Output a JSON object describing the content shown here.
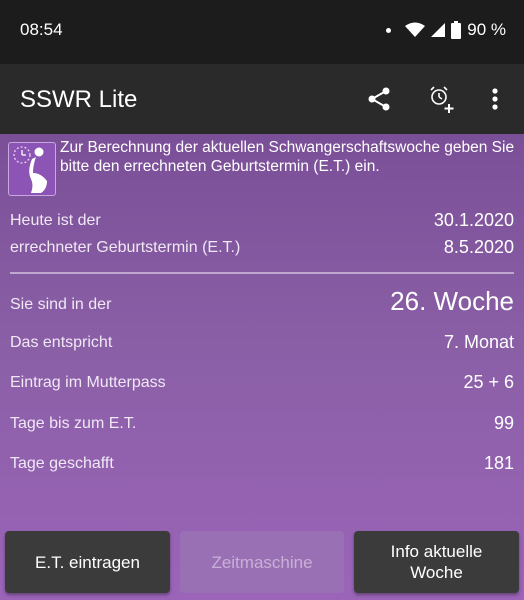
{
  "status": {
    "time": "08:54",
    "battery": "90 %"
  },
  "appbar": {
    "title": "SSWR Lite",
    "icons": [
      "share-icon",
      "alarm-add-icon",
      "more-vert-icon"
    ]
  },
  "intro": {
    "text": "Zur Berechnung der aktuellen Schwangerschaftswoche geben Sie bitte den errechneten Geburtstermin (E.T.) ein."
  },
  "rows": [
    {
      "label": "Heute ist der",
      "value": "30.1.2020"
    },
    {
      "label": "errechneter Geburtstermin (E.T.)",
      "value": "8.5.2020"
    },
    {
      "label": "Sie sind in der",
      "value": "26. Woche"
    },
    {
      "label": "Das entspricht",
      "value": "7. Monat"
    },
    {
      "label": "Eintrag im Mutterpass",
      "value": "25 + 6"
    },
    {
      "label": "Tage bis zum E.T.",
      "value": "99"
    },
    {
      "label": "Tage geschafft",
      "value": "181"
    }
  ],
  "buttons": {
    "enter_due_date": "E.T. eintragen",
    "time_machine": "Zeitmaschine",
    "info_week": "Info aktuelle Woche"
  },
  "colors": {
    "background": "#7b4a93",
    "appbar": "#2a2a2a",
    "statusbar": "#1c1c1c"
  }
}
